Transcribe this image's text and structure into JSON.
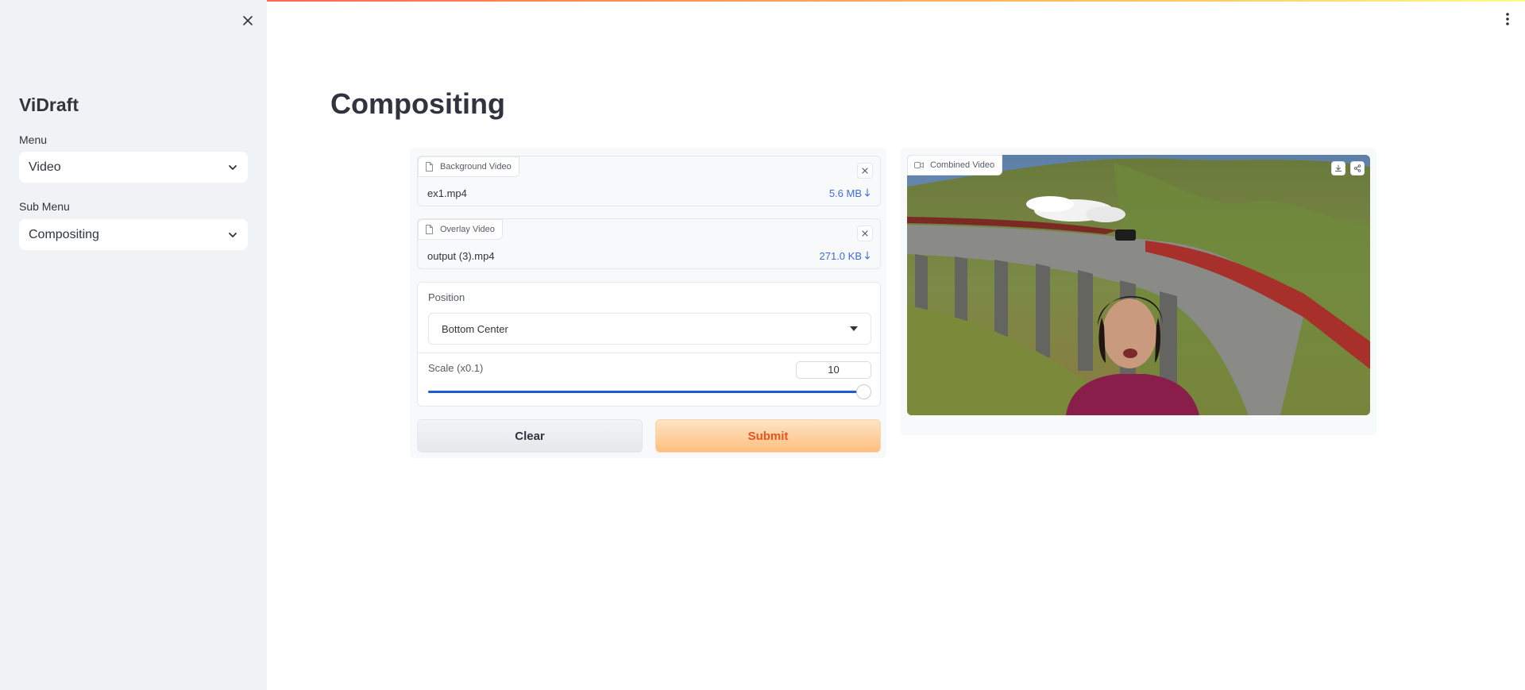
{
  "sidebar": {
    "brand": "ViDraft",
    "menu_label": "Menu",
    "menu_value": "Video",
    "submenu_label": "Sub Menu",
    "submenu_value": "Compositing"
  },
  "main": {
    "title": "Compositing"
  },
  "inputs": {
    "background": {
      "label": "Background Video",
      "file_name": "ex1.mp4",
      "file_size": "5.6 MB"
    },
    "overlay": {
      "label": "Overlay Video",
      "file_name": "output (3).mp4",
      "file_size": "271.0 KB"
    }
  },
  "position": {
    "label": "Position",
    "value": "Bottom Center"
  },
  "scale": {
    "label": "Scale (x0.1)",
    "value": "10",
    "fraction": 1.0
  },
  "buttons": {
    "clear": "Clear",
    "submit": "Submit"
  },
  "output": {
    "label": "Combined Video"
  },
  "icons": [
    "close-icon",
    "kebab-menu-icon",
    "chevron-down-icon",
    "file-icon",
    "video-camera-icon",
    "download-icon",
    "share-icon",
    "dropdown-triangle-icon"
  ]
}
